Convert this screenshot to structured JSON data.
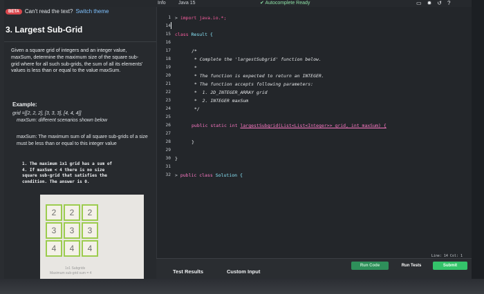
{
  "topbar": {
    "info": "Info",
    "lang": "Java 15",
    "autocomplete": "Autocomplete Ready",
    "icons": [
      "layout-icon",
      "brightness-icon",
      "history-icon",
      "help-icon"
    ]
  },
  "left": {
    "beta": "BETA",
    "cant_read": "Can't read the text?",
    "switch_theme": "Switch theme",
    "title": "3. Largest Sub-Grid",
    "description": "Given a square grid of integers and an integer value, maxSum, determine the maximum size of the square sub-grid where for all such sub-grids, the sum of all its elements' values is less than or equal to the value maxSum.",
    "example_heading": "Example:",
    "example_grid": "grid =[[2, 2, 2], [3, 3, 3], [4, 4, 4]]",
    "example_sum": "maxSum: different scenarios shown below",
    "maxsum_desc": "maxSum: The maximum sum of all square sub-grids of a size must be less than or equal to this integer value",
    "note_lines": [
      "1. The maximum 1x1 grid has a sum of",
      "4. If maxSum < 4 there is no size",
      "square sub-grid that satisfies the",
      "condition. The answer is 0."
    ],
    "grid": [
      [
        2,
        2,
        2
      ],
      [
        3,
        3,
        3
      ],
      [
        4,
        4,
        4
      ]
    ],
    "diagram_caption1": "1x1 Subgrids",
    "diagram_caption2": "Maximum sub-grid sum = 4"
  },
  "editor": {
    "line_numbers": [
      "1",
      "14",
      "15",
      "16",
      "17",
      "18",
      "19",
      "20",
      "21",
      "22",
      "23",
      "24",
      "25",
      "26",
      "27",
      "28",
      "29",
      "30",
      "31",
      "32"
    ],
    "import_line": "import java.io.*;",
    "class_line_kw": "class",
    "class_line_name": "Result {",
    "comment_open": "/*",
    "comment_lines": [
      " * Complete the 'largestSubgrid' function below.",
      " *",
      " * The function is expected to return an INTEGER.",
      " * The function accepts following parameters:",
      " *  1. 2D_INTEGER_ARRAY grid",
      " *  2. INTEGER maxSum",
      " */"
    ],
    "method_sig_prefix": "public static int",
    "method_sig": "largestSubgrid(List<List<Integer>> grid, int maxSum) {",
    "close_brace": "}",
    "class_close": "}",
    "solution_kw": "public class",
    "solution_name": "Solution {",
    "line_col": "Line: 14 Col: 1"
  },
  "bottom": {
    "test_results": "Test Results",
    "custom_input": "Custom Input",
    "run_code": "Run Code",
    "run_tests": "Run Tests",
    "submit": "Submit"
  }
}
